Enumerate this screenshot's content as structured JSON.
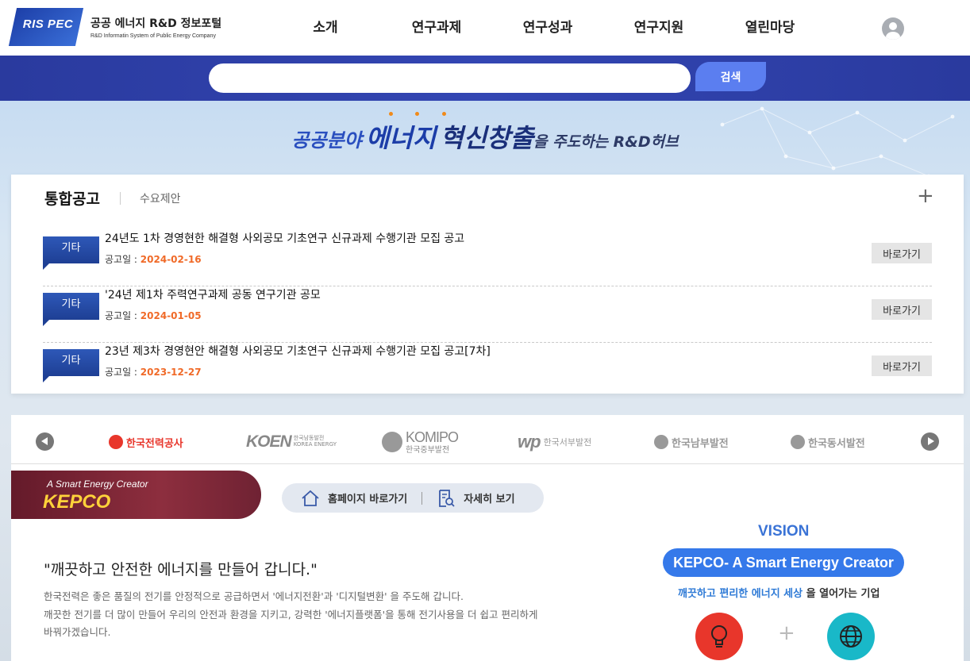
{
  "header": {
    "logo_box": "RIS PEC",
    "logo_title": "공공 에너지 R&D 정보포털",
    "logo_subtitle": "R&D Informatin System of Public Energy Company",
    "nav": [
      "소개",
      "연구과제",
      "연구성과",
      "연구지원",
      "열린마당"
    ],
    "user_icon": "user-icon"
  },
  "search": {
    "placeholder": "",
    "value": "",
    "button_label": "검색"
  },
  "hero": {
    "slogan_part1": "공공분야",
    "slogan_part2": "에너지",
    "slogan_part3": "혁신창출",
    "slogan_part4": "을 주도하는 R&D허브",
    "dot_color": "#f08a1a"
  },
  "notice": {
    "tab_main": "통합공고",
    "tab_sub": "수요제안",
    "more_label": "+",
    "date_label": "공고일 : ",
    "items": [
      {
        "badge": "기타",
        "title": "24년도 1차 경영현한 해결형 사외공모 기초연구 신규과제 수행기관 모집 공고",
        "date": "2024-02-16",
        "button": "바로가기"
      },
      {
        "badge": "기타",
        "title": "'24년 제1차 주력연구과제 공동 연구기관 공모",
        "date": "2024-01-05",
        "button": "바로가기"
      },
      {
        "badge": "기타",
        "title": "23년 제3차 경영현안 해결형 사외공모 기초연구 신규과제 수행기관 모집 공고[7차]",
        "date": "2023-12-27",
        "button": "바로가기"
      }
    ]
  },
  "companies": {
    "logos": [
      {
        "name": "한국전력공사",
        "color": "#e8362b"
      },
      {
        "big": "KOEN",
        "small1": "한국남동발전",
        "small2": "KOREA ENERGY"
      },
      {
        "big": "KOMIPO",
        "small1": "한국중부발전"
      },
      {
        "big": "wp",
        "name": "한국서부발전"
      },
      {
        "name": "한국남부발전",
        "color": "#999999"
      },
      {
        "name": "한국동서발전",
        "color": "#999999"
      }
    ],
    "selected": {
      "tagline": "A Smart Energy Creator",
      "name": "KEPCO",
      "homepage_label": "홈페이지 바로가기",
      "detail_label": "자세히 보기",
      "quote": "\"깨끗하고 안전한 에너지를 만들어 갑니다.\"",
      "desc_line1": "한국전력은 좋은 품질의 전기를 안정적으로 공급하면서 '에너지전환'과 '디지털변환' 을 주도해 갑니다.",
      "desc_line2": "깨끗한 전기를 더 많이 만들어 우리의 안전과 환경을 지키고, 강력한 '에너지플랫폼'을 통해 전기사용을 더 쉽고 편리하게",
      "desc_line3": "바꿔가겠습니다.",
      "vision_title": "VISION",
      "vision_slogan": "KEPCO- A Smart Energy Creator",
      "vision_sub_hl": "깨끗하고 편리한 에너지 세상",
      "vision_sub_rest": " 을 열어가는 기업",
      "plus": "+"
    }
  }
}
